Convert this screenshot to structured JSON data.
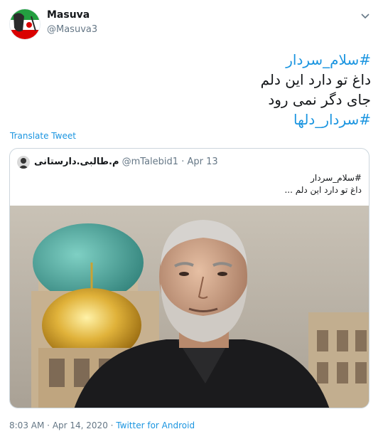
{
  "author": {
    "name": "Masuva",
    "handle": "@Masuva3",
    "avatar_icon": "iran-flag-avatar-icon"
  },
  "tweet": {
    "lines": [
      {
        "text": "#سلام_سردار",
        "hashtag": true
      },
      {
        "text": "داغ تو دارد این دلم",
        "hashtag": false
      },
      {
        "text": "جای دگر نمی رود",
        "hashtag": false
      },
      {
        "text": "#سردار_دلها",
        "hashtag": true
      }
    ],
    "translate_label": "Translate Tweet"
  },
  "quoted": {
    "name": "م.طالبی.دارستانی",
    "handle": "@mTalebid1",
    "separator": "·",
    "date": "Apr 13",
    "line1": "#سلام_سردار",
    "line2": "داغ تو دارد این دلم ...",
    "image_icon": "portrait-shrine-photo"
  },
  "footer": {
    "time": "8:03 AM",
    "dot": "·",
    "date": "Apr 14, 2020",
    "dot2": "·",
    "source": "Twitter for Android"
  },
  "colors": {
    "link": "#1b95e0",
    "meta": "#657786",
    "border": "#ccd6dd"
  }
}
